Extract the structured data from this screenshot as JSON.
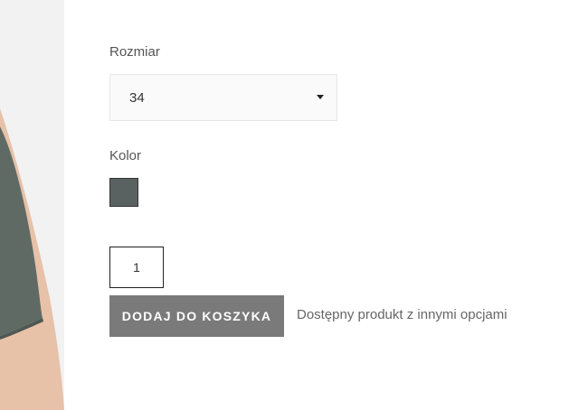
{
  "product": {
    "size_label": "Rozmiar",
    "size_selected": "34",
    "color_label": "Kolor",
    "color_swatch": "#5a6261",
    "quantity": "1",
    "add_to_cart_label": "DODAJ DO KOSZYKA",
    "availability_text": "Dostępny produkt z innymi opcjami"
  },
  "icons": {
    "dropdown": "caret-down-icon"
  },
  "colors": {
    "button_bg": "#7a7a7a",
    "garment": "#5f6a65",
    "image_bg": "#f2f2f2"
  }
}
